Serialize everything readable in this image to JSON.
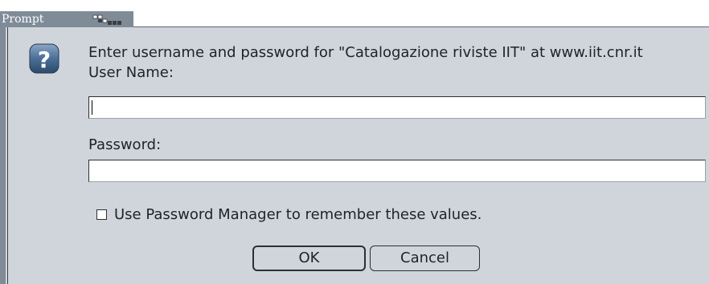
{
  "window": {
    "title": "Prompt"
  },
  "dialog": {
    "message": "Enter username and password for \"Catalogazione riviste IIT\" at www.iit.cnr.it",
    "username_label": "User Name:",
    "username_value": "",
    "password_label": "Password:",
    "password_value": "",
    "remember_label": "Use Password Manager to remember these values.",
    "remember_checked": false,
    "ok_label": "OK",
    "cancel_label": "Cancel"
  },
  "icons": {
    "question": "question-icon",
    "title_decoration": "grip-icon"
  },
  "colors": {
    "titlebar": "#7f8c98",
    "dialog_bg": "#cfd5db",
    "icon_blue": "#4a6f97"
  }
}
